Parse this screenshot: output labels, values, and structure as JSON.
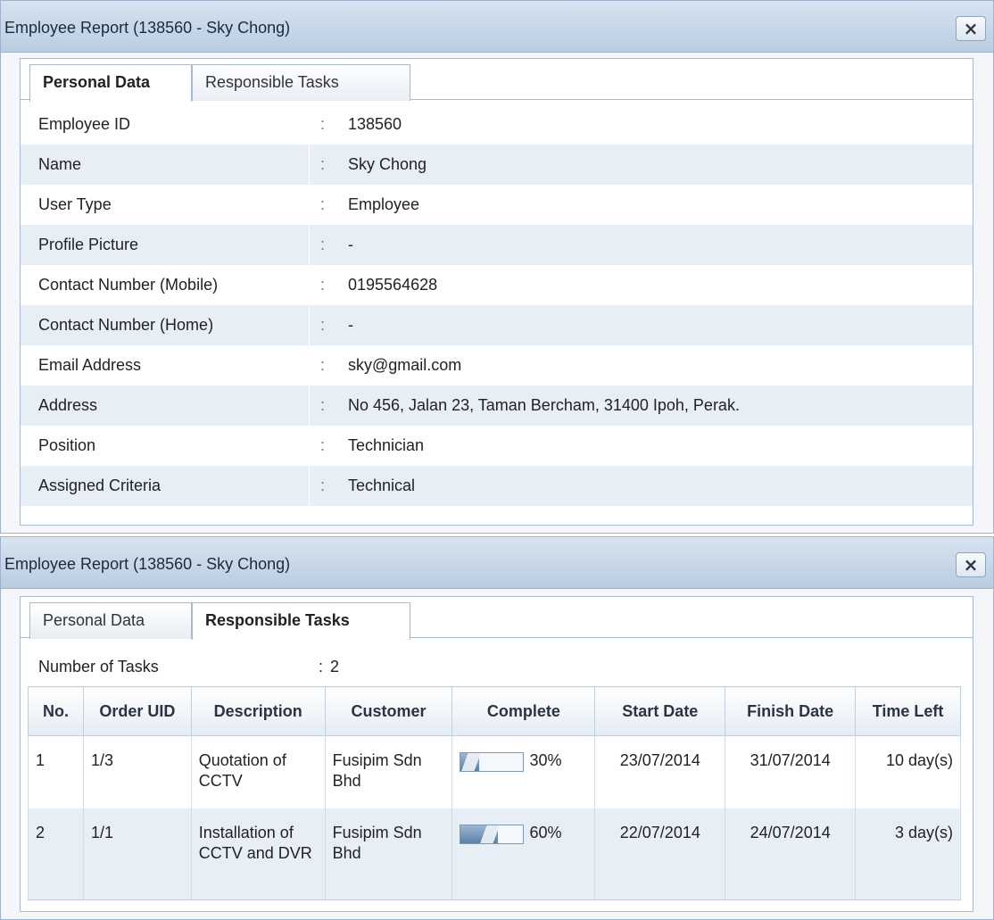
{
  "dialog1": {
    "title": "Employee Report (138560 - Sky Chong)",
    "close": "×",
    "tabs": [
      "Personal Data",
      "Responsible Tasks"
    ],
    "active_tab": 0,
    "rows": [
      {
        "label": "Employee ID",
        "value": "138560"
      },
      {
        "label": "Name",
        "value": "Sky Chong"
      },
      {
        "label": "User Type",
        "value": "Employee"
      },
      {
        "label": "Profile Picture",
        "value": "-"
      },
      {
        "label": "Contact Number (Mobile)",
        "value": "0195564628"
      },
      {
        "label": "Contact Number (Home)",
        "value": "-"
      },
      {
        "label": "Email Address",
        "value": "sky@gmail.com"
      },
      {
        "label": "Address",
        "value": "No 456, Jalan 23, Taman Bercham, 31400 Ipoh, Perak."
      },
      {
        "label": "Position",
        "value": "Technician"
      },
      {
        "label": "Assigned Criteria",
        "value": "Technical"
      }
    ],
    "colon": ":"
  },
  "dialog2": {
    "title": "Employee Report (138560 - Sky Chong)",
    "close": "×",
    "tabs": [
      "Personal Data",
      "Responsible Tasks"
    ],
    "active_tab": 1,
    "number_of_tasks_label": "Number of Tasks",
    "colon": ":",
    "number_of_tasks": "2",
    "columns": [
      "No.",
      "Order UID",
      "Description",
      "Customer",
      "Complete",
      "Start Date",
      "Finish Date",
      "Time Left"
    ],
    "tasks": [
      {
        "no": "1",
        "order_uid": "1/3",
        "description": "Quotation of CCTV",
        "customer": "Fusipim Sdn Bhd",
        "complete": 30,
        "complete_text": "30%",
        "start_date": "23/07/2014",
        "finish_date": "31/07/2014",
        "time_left": "10 day(s)"
      },
      {
        "no": "2",
        "order_uid": "1/1",
        "description": "Installation of CCTV and DVR",
        "customer": "Fusipim Sdn Bhd",
        "complete": 60,
        "complete_text": "60%",
        "start_date": "22/07/2014",
        "finish_date": "24/07/2014",
        "time_left": "3 day(s)"
      }
    ]
  },
  "colors": {
    "titlebar": "#c5d6e8",
    "row_alt": "#e8eef5",
    "progress_fill": "#5b7fa8"
  },
  "icons": {
    "close": "close-icon"
  }
}
